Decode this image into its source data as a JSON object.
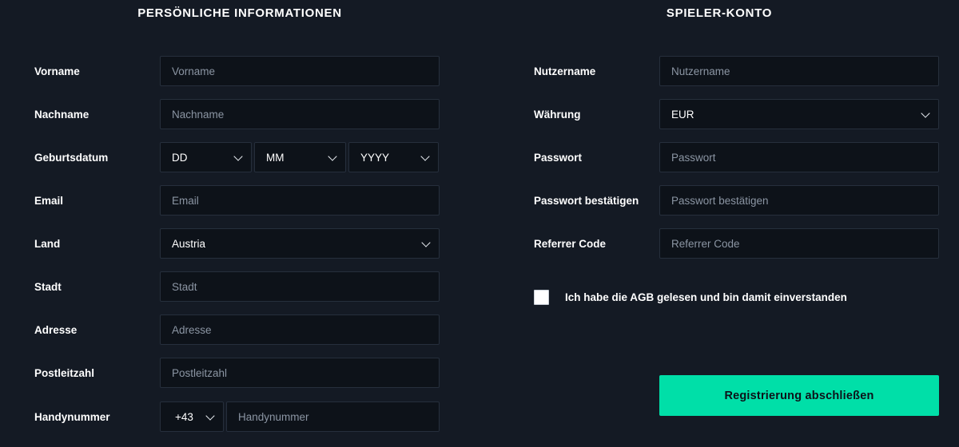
{
  "colors": {
    "page_background": "#141a24",
    "input_background": "#0d1219",
    "input_border": "#262f3c",
    "placeholder": "#8b95a3",
    "label": "#ffffff",
    "accent": "#00dfa8",
    "accent_text": "#0d1219"
  },
  "personal": {
    "title": "PERSÖNLICHE INFORMATIONEN",
    "fields": {
      "first_name": {
        "label": "Vorname",
        "placeholder": "Vorname"
      },
      "last_name": {
        "label": "Nachname",
        "placeholder": "Nachname"
      },
      "birthdate": {
        "label": "Geburtsdatum",
        "day": "DD",
        "month": "MM",
        "year": "YYYY"
      },
      "email": {
        "label": "Email",
        "placeholder": "Email"
      },
      "country": {
        "label": "Land",
        "value": "Austria"
      },
      "city": {
        "label": "Stadt",
        "placeholder": "Stadt"
      },
      "address": {
        "label": "Adresse",
        "placeholder": "Adresse"
      },
      "postal_code": {
        "label": "Postleitzahl",
        "placeholder": "Postleitzahl"
      },
      "phone": {
        "label": "Handynummer",
        "dial_code": "+43",
        "placeholder": "Handynummer"
      }
    }
  },
  "account": {
    "title": "SPIELER-KONTO",
    "fields": {
      "username": {
        "label": "Nutzername",
        "placeholder": "Nutzername"
      },
      "currency": {
        "label": "Währung",
        "value": "EUR"
      },
      "password": {
        "label": "Passwort",
        "placeholder": "Passwort"
      },
      "password_confirm": {
        "label": "Passwort bestätigen",
        "placeholder": "Passwort bestätigen"
      },
      "referrer_code": {
        "label": "Referrer Code",
        "placeholder": "Referrer Code"
      }
    },
    "terms": {
      "label": "Ich habe die AGB gelesen und bin damit einverstanden",
      "checked": false
    },
    "submit_label": "Registrierung abschließen"
  }
}
